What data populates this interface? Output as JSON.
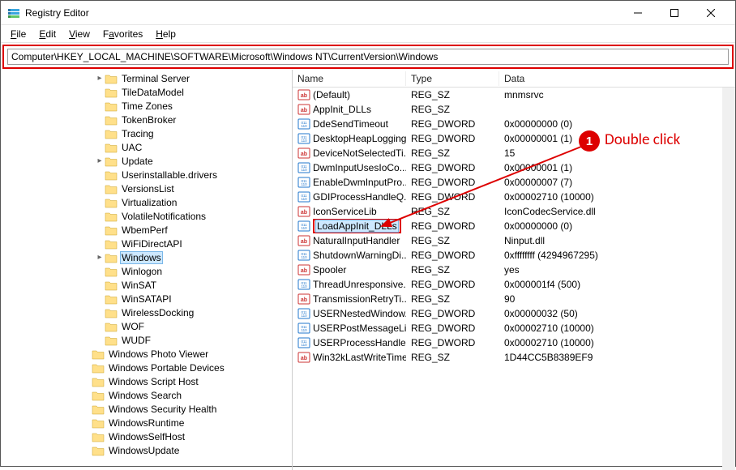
{
  "window": {
    "title": "Registry Editor"
  },
  "menu": {
    "file": "File",
    "edit": "Edit",
    "view": "View",
    "favorites": "Favorites",
    "help": "Help"
  },
  "address": "Computer\\HKEY_LOCAL_MACHINE\\SOFTWARE\\Microsoft\\Windows NT\\CurrentVersion\\Windows",
  "tree": [
    {
      "level": 7,
      "chev": ">",
      "label": "Terminal Server"
    },
    {
      "level": 7,
      "chev": "",
      "label": "TileDataModel"
    },
    {
      "level": 7,
      "chev": "",
      "label": "Time Zones"
    },
    {
      "level": 7,
      "chev": "",
      "label": "TokenBroker"
    },
    {
      "level": 7,
      "chev": "",
      "label": "Tracing"
    },
    {
      "level": 7,
      "chev": "",
      "label": "UAC"
    },
    {
      "level": 7,
      "chev": ">",
      "label": "Update"
    },
    {
      "level": 7,
      "chev": "",
      "label": "Userinstallable.drivers"
    },
    {
      "level": 7,
      "chev": "",
      "label": "VersionsList"
    },
    {
      "level": 7,
      "chev": "",
      "label": "Virtualization"
    },
    {
      "level": 7,
      "chev": "",
      "label": "VolatileNotifications"
    },
    {
      "level": 7,
      "chev": "",
      "label": "WbemPerf"
    },
    {
      "level": 7,
      "chev": "",
      "label": "WiFiDirectAPI"
    },
    {
      "level": 7,
      "chev": ">",
      "label": "Windows",
      "selected": true
    },
    {
      "level": 7,
      "chev": "",
      "label": "Winlogon"
    },
    {
      "level": 7,
      "chev": "",
      "label": "WinSAT"
    },
    {
      "level": 7,
      "chev": "",
      "label": "WinSATAPI"
    },
    {
      "level": 7,
      "chev": "",
      "label": "WirelessDocking"
    },
    {
      "level": 7,
      "chev": "",
      "label": "WOF"
    },
    {
      "level": 7,
      "chev": "",
      "label": "WUDF"
    },
    {
      "level": 6,
      "chev": "",
      "label": "Windows Photo Viewer"
    },
    {
      "level": 6,
      "chev": "",
      "label": "Windows Portable Devices"
    },
    {
      "level": 6,
      "chev": "",
      "label": "Windows Script Host"
    },
    {
      "level": 6,
      "chev": "",
      "label": "Windows Search"
    },
    {
      "level": 6,
      "chev": "",
      "label": "Windows Security Health"
    },
    {
      "level": 6,
      "chev": "",
      "label": "WindowsRuntime"
    },
    {
      "level": 6,
      "chev": "",
      "label": "WindowsSelfHost"
    },
    {
      "level": 6,
      "chev": "",
      "label": "WindowsUpdate"
    }
  ],
  "columns": {
    "name": "Name",
    "type": "Type",
    "data": "Data"
  },
  "values": [
    {
      "icon": "sz",
      "name": "(Default)",
      "type": "REG_SZ",
      "data": "mnmsrvc"
    },
    {
      "icon": "sz",
      "name": "AppInit_DLLs",
      "type": "REG_SZ",
      "data": ""
    },
    {
      "icon": "dw",
      "name": "DdeSendTimeout",
      "type": "REG_DWORD",
      "data": "0x00000000 (0)"
    },
    {
      "icon": "dw",
      "name": "DesktopHeapLogging",
      "type": "REG_DWORD",
      "data": "0x00000001 (1)"
    },
    {
      "icon": "sz",
      "name": "DeviceNotSelectedTi...",
      "type": "REG_SZ",
      "data": "15"
    },
    {
      "icon": "dw",
      "name": "DwmInputUsesIoCo...",
      "type": "REG_DWORD",
      "data": "0x00000001 (1)"
    },
    {
      "icon": "dw",
      "name": "EnableDwmInputPro...",
      "type": "REG_DWORD",
      "data": "0x00000007 (7)"
    },
    {
      "icon": "dw",
      "name": "GDIProcessHandleQ...",
      "type": "REG_DWORD",
      "data": "0x00002710 (10000)"
    },
    {
      "icon": "sz",
      "name": "IconServiceLib",
      "type": "REG_SZ",
      "data": "IconCodecService.dll"
    },
    {
      "icon": "dw",
      "name": "LoadAppInit_DLLs",
      "type": "REG_DWORD",
      "data": "0x00000000 (0)",
      "highlight": true
    },
    {
      "icon": "sz",
      "name": "NaturalInputHandler",
      "type": "REG_SZ",
      "data": "Ninput.dll"
    },
    {
      "icon": "dw",
      "name": "ShutdownWarningDi...",
      "type": "REG_DWORD",
      "data": "0xffffffff (4294967295)"
    },
    {
      "icon": "sz",
      "name": "Spooler",
      "type": "REG_SZ",
      "data": "yes"
    },
    {
      "icon": "dw",
      "name": "ThreadUnresponsive...",
      "type": "REG_DWORD",
      "data": "0x000001f4 (500)"
    },
    {
      "icon": "sz",
      "name": "TransmissionRetryTi...",
      "type": "REG_SZ",
      "data": "90"
    },
    {
      "icon": "dw",
      "name": "USERNestedWindow...",
      "type": "REG_DWORD",
      "data": "0x00000032 (50)"
    },
    {
      "icon": "dw",
      "name": "USERPostMessageLi...",
      "type": "REG_DWORD",
      "data": "0x00002710 (10000)"
    },
    {
      "icon": "dw",
      "name": "USERProcessHandle...",
      "type": "REG_DWORD",
      "data": "0x00002710 (10000)"
    },
    {
      "icon": "sz",
      "name": "Win32kLastWriteTime",
      "type": "REG_SZ",
      "data": "1D44CC5B8389EF9"
    }
  ],
  "annotation": {
    "num": "1",
    "text": "Double click"
  }
}
